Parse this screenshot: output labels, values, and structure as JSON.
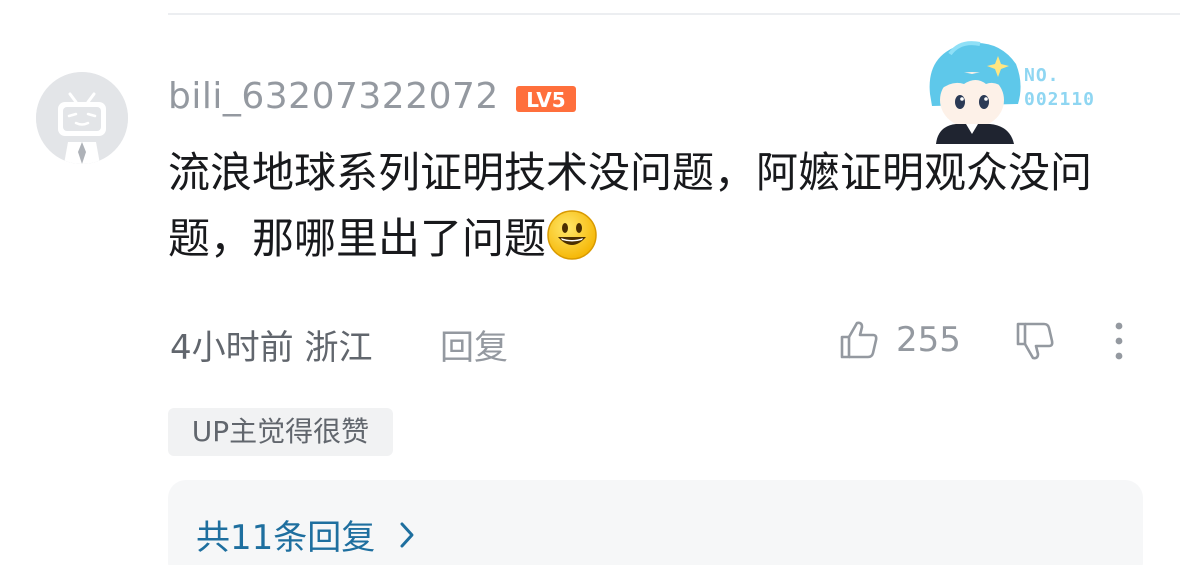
{
  "comment": {
    "username": "bili_63207322072",
    "level_badge": "LV5",
    "decoration": {
      "label_line1": "NO.",
      "label_line2": "002110"
    },
    "text": "流浪地球系列证明技术没问题，阿嬷证明观众没问题，那哪里出了问题",
    "emoji": "smiley-emoji",
    "time": "4小时前",
    "location": "浙江",
    "reply_label": "回复",
    "like_count": "255",
    "up_badge": "UP主觉得很赞",
    "replies_link": "共11条回复"
  },
  "colors": {
    "username": "#9499a0",
    "level_badge": "#ff6f3c",
    "replies_link": "#1e6f9f",
    "text": "#18191c"
  }
}
